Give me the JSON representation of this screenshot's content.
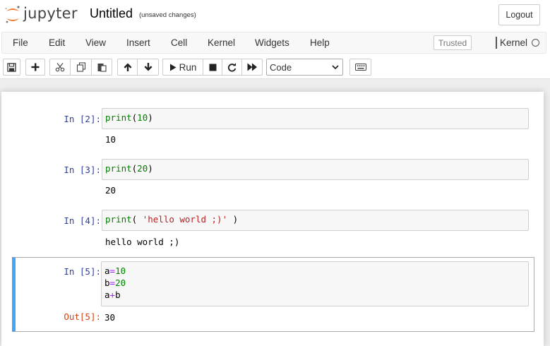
{
  "header": {
    "logo_text": "jupyter",
    "notebook_name": "Untitled",
    "save_status": "(unsaved changes)",
    "logout_label": "Logout"
  },
  "menubar": {
    "items": [
      "File",
      "Edit",
      "View",
      "Insert",
      "Cell",
      "Kernel",
      "Widgets",
      "Help"
    ],
    "trusted_label": "Trusted",
    "kernel_label": "Kernel"
  },
  "toolbar": {
    "buttons": [
      "save-icon",
      "plus-icon",
      "cut-icon",
      "copy-icon",
      "paste-icon",
      "arrow-up-icon",
      "arrow-down-icon",
      "play-icon",
      "stop-icon",
      "restart-icon",
      "fast-forward-icon",
      "keyboard-icon"
    ],
    "run_label": "Run",
    "cell_type": "Code"
  },
  "colors": {
    "selected_cell_border": "#42a5f5",
    "in_prompt": "#303f9f",
    "out_prompt": "#d84315",
    "builtin": "#008000",
    "string": "#ba2121",
    "operator": "#aa22ff"
  },
  "cells": [
    {
      "in_prompt": "In [2]:",
      "code": {
        "builtin": "print",
        "open": "(",
        "arg": "10",
        "close": ")"
      },
      "output": "10"
    },
    {
      "in_prompt": "In [3]:",
      "code": {
        "builtin": "print",
        "open": "(",
        "arg": "20",
        "close": ")"
      },
      "output": "20"
    },
    {
      "in_prompt": "In [4]:",
      "code": {
        "builtin": "print",
        "open": "( ",
        "arg": "'hello world ;)'",
        "close": " )"
      },
      "output": "hello world ;)"
    },
    {
      "in_prompt": "In [5]:",
      "out_prompt": "Out[5]:",
      "lines": [
        {
          "a": "a",
          "op": "=",
          "b": "10"
        },
        {
          "a": "b",
          "op": "=",
          "b": "20"
        },
        {
          "a": "a",
          "op": "+",
          "b": "b"
        }
      ],
      "output": "30"
    }
  ]
}
